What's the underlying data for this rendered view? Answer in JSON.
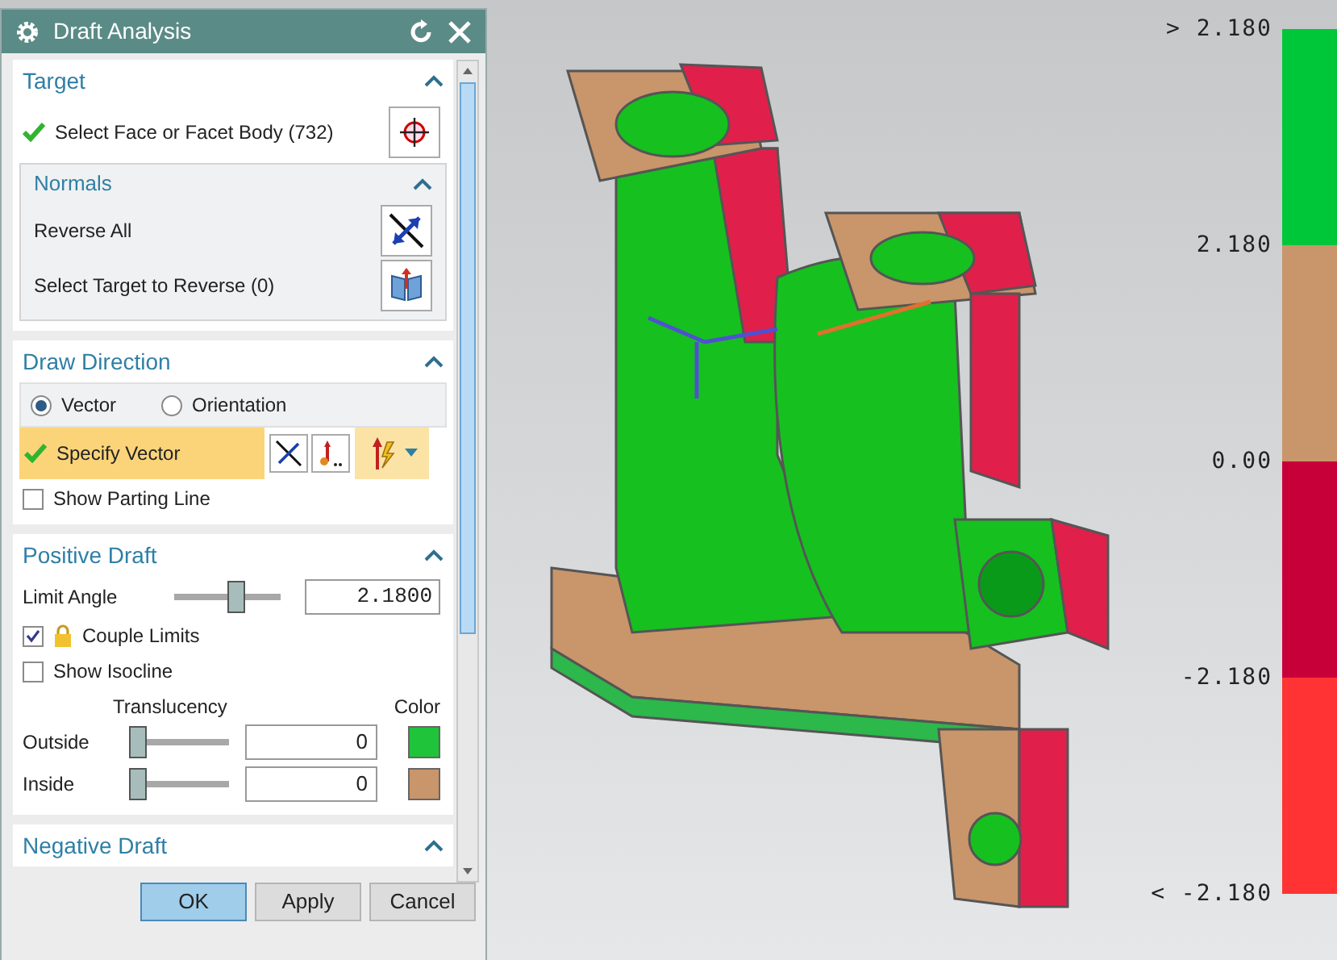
{
  "window": {
    "title": "Draft Analysis"
  },
  "target": {
    "title": "Target",
    "expanded": true,
    "select": {
      "label": "Select Face or Facet Body (732)",
      "done": true
    },
    "normals": {
      "title": "Normals",
      "expanded": true,
      "rows": [
        {
          "label": "Reverse All",
          "kind": "reverse"
        },
        {
          "label": "Select Target to Reverse (0)",
          "kind": "select"
        }
      ]
    }
  },
  "draw_direction": {
    "title": "Draw Direction",
    "expanded": true,
    "radios": [
      {
        "label": "Vector",
        "selected": true
      },
      {
        "label": "Orientation",
        "selected": false
      }
    ],
    "specify_vector": {
      "label": "Specify Vector",
      "done": true
    },
    "show_parting_line": {
      "label": "Show Parting Line",
      "checked": false
    }
  },
  "positive_draft": {
    "title": "Positive Draft",
    "expanded": true,
    "limit_angle": {
      "label": "Limit Angle",
      "value": "2.1800",
      "level": 0.6
    },
    "couple_limits": {
      "label": "Couple Limits",
      "checked": true
    },
    "show_isocline": {
      "label": "Show Isocline",
      "checked": false
    },
    "translucency_header": "Translucency",
    "color_header": "Color",
    "rows": [
      {
        "label": "Outside",
        "value": "0",
        "level": 0,
        "color": "#1fc43a"
      },
      {
        "label": "Inside",
        "value": "0",
        "level": 0,
        "color": "#c9956a"
      }
    ]
  },
  "negative_draft": {
    "title": "Negative Draft",
    "expanded": true
  },
  "buttons": [
    {
      "label": "OK",
      "default": true
    },
    {
      "label": "Apply",
      "default": false
    },
    {
      "label": "Cancel",
      "default": false
    }
  ],
  "legend": {
    "labels": [
      "> 2.180",
      "2.180",
      "0.00",
      "-2.180",
      "< -2.180"
    ],
    "bands": [
      {
        "color": "#00c73a"
      },
      {
        "color": "#c8966a"
      },
      {
        "color": "#c8003a"
      },
      {
        "color": "#ff3333"
      }
    ]
  }
}
